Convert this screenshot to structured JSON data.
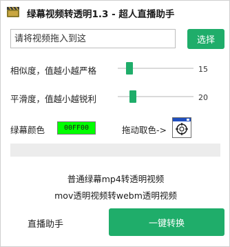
{
  "window": {
    "title": "绿幕视频转透明1.3 - 超人直播助手",
    "icon": "film-clapper-icon"
  },
  "file": {
    "placeholder": "请将视频拖入到这",
    "browse_label": "选择"
  },
  "settings": {
    "similarity": {
      "label": "相似度，值越小越严格",
      "value": "15",
      "level": 0.15
    },
    "smoothness": {
      "label": "平滑度，值越小越锐利",
      "value": "20",
      "level": 0.2
    },
    "key_color": {
      "label": "绿幕颜色",
      "hex": "00FF00"
    },
    "picker": {
      "label": "拖动取色->",
      "icon": "eyedropper-target-icon"
    }
  },
  "progress": {
    "value": 0
  },
  "outputs": {
    "mp4_option": "普通绿幕mp4转透明视频",
    "mov_option": "mov透明视频转webm透明视频"
  },
  "actions": {
    "live_assistant": "直播助手",
    "convert": "一键转换"
  },
  "colors": {
    "accent": "#1fad6a",
    "key_swatch": "#00ff00",
    "track": "#dadada",
    "progress_bg": "#ececec"
  }
}
